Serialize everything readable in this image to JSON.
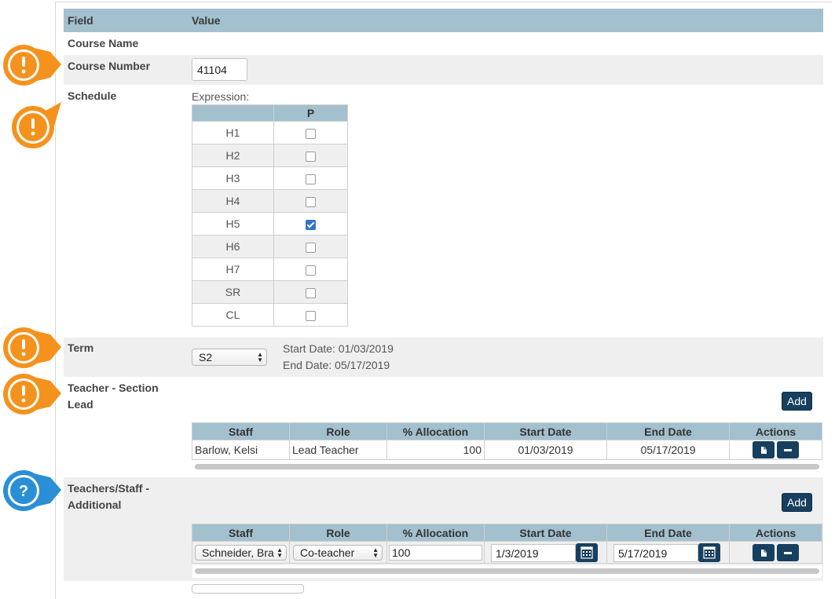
{
  "header": {
    "field_label": "Field",
    "value_label": "Value"
  },
  "course_name": {
    "label": "Course Name"
  },
  "course_number": {
    "label": "Course Number",
    "value": "41104"
  },
  "schedule": {
    "label": "Schedule",
    "expression_label": "Expression:",
    "column_header": "P",
    "periods": [
      {
        "name": "H1",
        "checked": false
      },
      {
        "name": "H2",
        "checked": false
      },
      {
        "name": "H3",
        "checked": false
      },
      {
        "name": "H4",
        "checked": false
      },
      {
        "name": "H5",
        "checked": true
      },
      {
        "name": "H6",
        "checked": false
      },
      {
        "name": "H7",
        "checked": false
      },
      {
        "name": "SR",
        "checked": false
      },
      {
        "name": "CL",
        "checked": false
      }
    ]
  },
  "term": {
    "label": "Term",
    "selected": "S2",
    "start_date": "Start Date: 01/03/2019",
    "end_date": "End Date: 05/17/2019"
  },
  "teacher_lead": {
    "label_line1": "Teacher - Section",
    "label_line2": "Lead",
    "add_label": "Add",
    "columns": [
      "Staff",
      "Role",
      "% Allocation",
      "Start Date",
      "End Date",
      "Actions"
    ],
    "row": {
      "staff": "Barlow, Kelsi",
      "role": "Lead Teacher",
      "allocation": "100",
      "start": "01/03/2019",
      "end": "05/17/2019"
    }
  },
  "teachers_additional": {
    "label_line1": "Teachers/Staff -",
    "label_line2": "Additional",
    "add_label": "Add",
    "columns": [
      "Staff",
      "Role",
      "% Allocation",
      "Start Date",
      "End Date",
      "Actions"
    ],
    "row": {
      "staff": "Schneider, Bra",
      "role": "Co-teacher",
      "allocation": "100",
      "start": "1/3/2019",
      "end": "5/17/2019"
    }
  },
  "colors": {
    "header_bg": "#a3c0ce",
    "button_bg": "#173f5f",
    "warning": "#f5921e",
    "help": "#2a8fd6"
  },
  "icons": {
    "warning": "exclamation-icon",
    "help": "question-icon",
    "details": "document-icon",
    "remove": "minus-icon",
    "calendar": "calendar-icon"
  }
}
